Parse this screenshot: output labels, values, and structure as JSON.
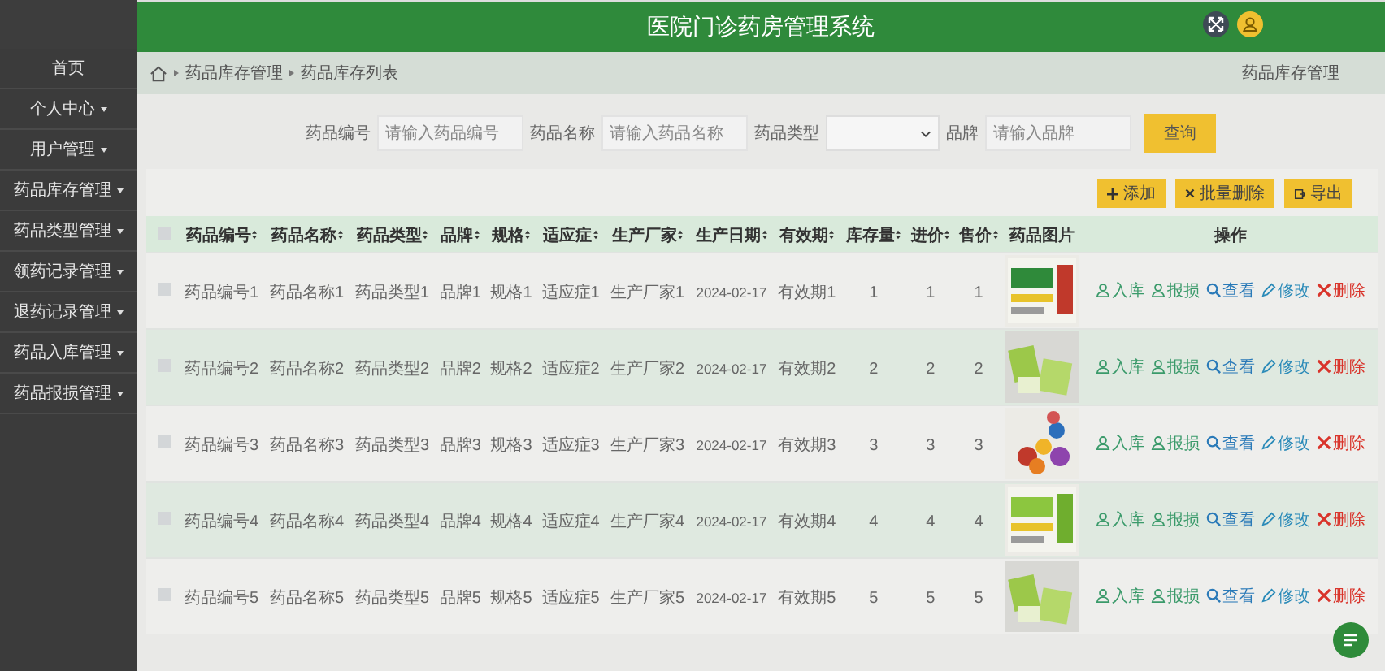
{
  "header": {
    "title": "医院门诊药房管理系统"
  },
  "sidebar": {
    "items": [
      {
        "label": "首页",
        "expandable": false
      },
      {
        "label": "个人中心",
        "expandable": true
      },
      {
        "label": "用户管理",
        "expandable": true
      },
      {
        "label": "药品库存管理",
        "expandable": true
      },
      {
        "label": "药品类型管理",
        "expandable": true
      },
      {
        "label": "领药记录管理",
        "expandable": true
      },
      {
        "label": "退药记录管理",
        "expandable": true
      },
      {
        "label": "药品入库管理",
        "expandable": true
      },
      {
        "label": "药品报损管理",
        "expandable": true
      }
    ]
  },
  "breadcrumb": {
    "items": [
      "药品库存管理",
      "药品库存列表"
    ],
    "page_title": "药品库存管理"
  },
  "search": {
    "fields": [
      {
        "kind": "text",
        "label": "药品编号",
        "placeholder": "请输入药品编号"
      },
      {
        "kind": "text",
        "label": "药品名称",
        "placeholder": "请输入药品名称"
      },
      {
        "kind": "select",
        "label": "药品类型"
      },
      {
        "kind": "text",
        "label": "品牌",
        "placeholder": "请输入品牌"
      }
    ],
    "button": "查询"
  },
  "toolbar": [
    {
      "kind": "add",
      "label": "添加"
    },
    {
      "kind": "batch-delete",
      "label": "批量删除"
    },
    {
      "kind": "export",
      "label": "导出"
    }
  ],
  "table": {
    "select_all_checked": false,
    "columns": [
      {
        "label": "药品编号",
        "sortable": true
      },
      {
        "label": "药品名称",
        "sortable": true
      },
      {
        "label": "药品类型",
        "sortable": true
      },
      {
        "label": "品牌",
        "sortable": true
      },
      {
        "label": "规格",
        "sortable": true
      },
      {
        "label": "适应症",
        "sortable": true
      },
      {
        "label": "生产厂家",
        "sortable": true
      },
      {
        "label": "生产日期",
        "sortable": true
      },
      {
        "label": "有效期",
        "sortable": true
      },
      {
        "label": "库存量",
        "sortable": true
      },
      {
        "label": "进价",
        "sortable": true
      },
      {
        "label": "售价",
        "sortable": true
      },
      {
        "label": "药品图片",
        "sortable": false
      },
      {
        "label": "操作",
        "sortable": false
      }
    ],
    "rows": [
      {
        "checked": false,
        "cells": [
          "药品编号1",
          "药品名称1",
          "药品类型1",
          "品牌1",
          "规格1",
          "适应症1",
          "生产厂家1",
          "2024-02-17",
          "有效期1",
          "1",
          "1",
          "1"
        ],
        "actions": [
          {
            "kind": "stock-in",
            "label": "入库"
          },
          {
            "kind": "report-loss",
            "label": "报损"
          },
          {
            "kind": "view",
            "label": "查看"
          },
          {
            "kind": "edit",
            "label": "修改"
          },
          {
            "kind": "delete",
            "label": "删除"
          }
        ]
      },
      {
        "checked": false,
        "cells": [
          "药品编号2",
          "药品名称2",
          "药品类型2",
          "品牌2",
          "规格2",
          "适应症2",
          "生产厂家2",
          "2024-02-17",
          "有效期2",
          "2",
          "2",
          "2"
        ],
        "actions": [
          {
            "kind": "stock-in",
            "label": "入库"
          },
          {
            "kind": "report-loss",
            "label": "报损"
          },
          {
            "kind": "view",
            "label": "查看"
          },
          {
            "kind": "edit",
            "label": "修改"
          },
          {
            "kind": "delete",
            "label": "删除"
          }
        ]
      },
      {
        "checked": false,
        "cells": [
          "药品编号3",
          "药品名称3",
          "药品类型3",
          "品牌3",
          "规格3",
          "适应症3",
          "生产厂家3",
          "2024-02-17",
          "有效期3",
          "3",
          "3",
          "3"
        ],
        "actions": [
          {
            "kind": "stock-in",
            "label": "入库"
          },
          {
            "kind": "report-loss",
            "label": "报损"
          },
          {
            "kind": "view",
            "label": "查看"
          },
          {
            "kind": "edit",
            "label": "修改"
          },
          {
            "kind": "delete",
            "label": "删除"
          }
        ]
      },
      {
        "checked": false,
        "cells": [
          "药品编号4",
          "药品名称4",
          "药品类型4",
          "品牌4",
          "规格4",
          "适应症4",
          "生产厂家4",
          "2024-02-17",
          "有效期4",
          "4",
          "4",
          "4"
        ],
        "actions": [
          {
            "kind": "stock-in",
            "label": "入库"
          },
          {
            "kind": "report-loss",
            "label": "报损"
          },
          {
            "kind": "view",
            "label": "查看"
          },
          {
            "kind": "edit",
            "label": "修改"
          },
          {
            "kind": "delete",
            "label": "删除"
          }
        ]
      },
      {
        "checked": false,
        "cells": [
          "药品编号5",
          "药品名称5",
          "药品类型5",
          "品牌5",
          "规格5",
          "适应症5",
          "生产厂家5",
          "2024-02-17",
          "有效期5",
          "5",
          "5",
          "5"
        ],
        "actions": [
          {
            "kind": "stock-in",
            "label": "入库"
          },
          {
            "kind": "report-loss",
            "label": "报损"
          },
          {
            "kind": "view",
            "label": "查看"
          },
          {
            "kind": "edit",
            "label": "修改"
          },
          {
            "kind": "delete",
            "label": "删除"
          }
        ]
      }
    ]
  }
}
